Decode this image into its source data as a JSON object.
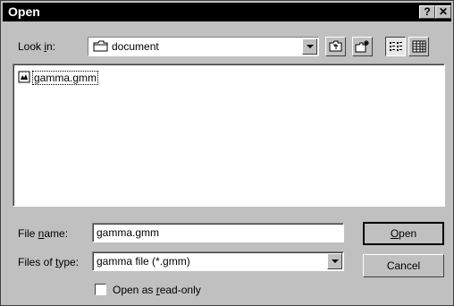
{
  "window": {
    "title": "Open",
    "help_glyph": "?",
    "close_glyph": "✕"
  },
  "look_in": {
    "label_pre": "Look ",
    "label_key": "i",
    "label_post": "n:",
    "value": "document",
    "icon": "folder-icon"
  },
  "toolbar": {
    "icons": [
      "up-one-level-icon",
      "create-new-folder-icon",
      "list-view-icon",
      "details-view-icon"
    ]
  },
  "files": [
    {
      "name": "gamma.gmm",
      "icon": "file-icon"
    }
  ],
  "file_name": {
    "label_pre": "File ",
    "label_key": "n",
    "label_post": "ame:",
    "value": "gamma.gmm"
  },
  "files_of_type": {
    "label_pre": "Files of ",
    "label_key": "t",
    "label_post": "ype:",
    "value": "gamma file (*.gmm)"
  },
  "readonly": {
    "label_pre": "Open as ",
    "label_key": "r",
    "label_post": "ead-only",
    "checked": false
  },
  "buttons": {
    "open_key": "O",
    "open_rest": "pen",
    "cancel": "Cancel"
  }
}
